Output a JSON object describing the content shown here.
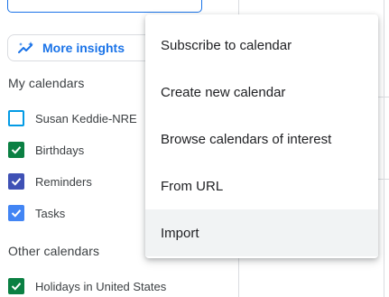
{
  "colors": {
    "accent": "#1a73e8",
    "checkbox_susan": "#039be5",
    "checkbox_birthdays": "#0b8043",
    "checkbox_reminders": "#3f51b5",
    "checkbox_tasks": "#4285f4",
    "checkbox_holidays": "#0b8043"
  },
  "sidebar": {
    "insights_button": {
      "label": "More insights",
      "icon": "insights-sparkle-icon"
    },
    "my_calendars": {
      "heading": "My calendars",
      "items": [
        {
          "label": "Susan Keddie-NRE",
          "checked": false
        },
        {
          "label": "Birthdays",
          "checked": true
        },
        {
          "label": "Reminders",
          "checked": true
        },
        {
          "label": "Tasks",
          "checked": true
        }
      ]
    },
    "other_calendars": {
      "heading": "Other calendars",
      "items": [
        {
          "label": "Holidays in United States",
          "checked": true
        }
      ]
    }
  },
  "menu": {
    "items": [
      {
        "label": "Subscribe to calendar"
      },
      {
        "label": "Create new calendar"
      },
      {
        "label": "Browse calendars of interest"
      },
      {
        "label": "From URL"
      },
      {
        "label": "Import",
        "hovered": true
      }
    ]
  }
}
